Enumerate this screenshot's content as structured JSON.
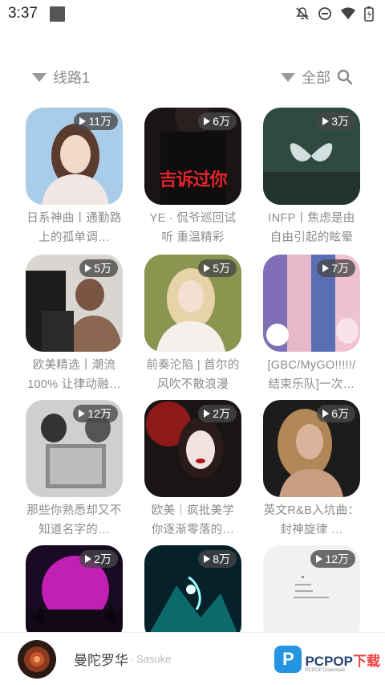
{
  "status_bar": {
    "time": "3:37",
    "icons": [
      "notification-off-icon",
      "do-not-disturb-icon",
      "wifi-icon",
      "battery-icon"
    ]
  },
  "filters": {
    "route_label": "线路1",
    "category_label": "全部"
  },
  "playlists": [
    {
      "title": "日系神曲丨通勤路上的孤单调…",
      "plays": "11万"
    },
    {
      "title": "YE · 侃爷巡回试听 重温精彩",
      "plays": "6万"
    },
    {
      "title": "INFP丨焦虑是由自由引起的眩晕",
      "plays": "3万"
    },
    {
      "title": "欧美精选丨潮流100% 让律动融…",
      "plays": "5万"
    },
    {
      "title": "前奏沦陷 | 首尔的风吹不散浪漫",
      "plays": "5万"
    },
    {
      "title": "[GBC/MyGO!!!!!/结束乐队]一次…",
      "plays": "7万"
    },
    {
      "title": "那些你熟悉却又不知道名字的…",
      "plays": "12万"
    },
    {
      "title": "欧美｜疯批美学 你逐渐零落的…",
      "plays": "2万"
    },
    {
      "title": "英文R&B入坑曲：封神旋律 …",
      "plays": "6万"
    },
    {
      "title": "",
      "plays": "2万"
    },
    {
      "title": "",
      "plays": "8万"
    },
    {
      "title": "",
      "plays": "12万"
    }
  ],
  "cover_texts": {
    "card2": "吉诉过你"
  },
  "player": {
    "song": "曼陀罗华",
    "artist": " · Sasuke"
  },
  "watermark": {
    "mark": "P",
    "brand": "PCPOP",
    "suffix": "下载",
    "sub": "PCPOP Download"
  }
}
